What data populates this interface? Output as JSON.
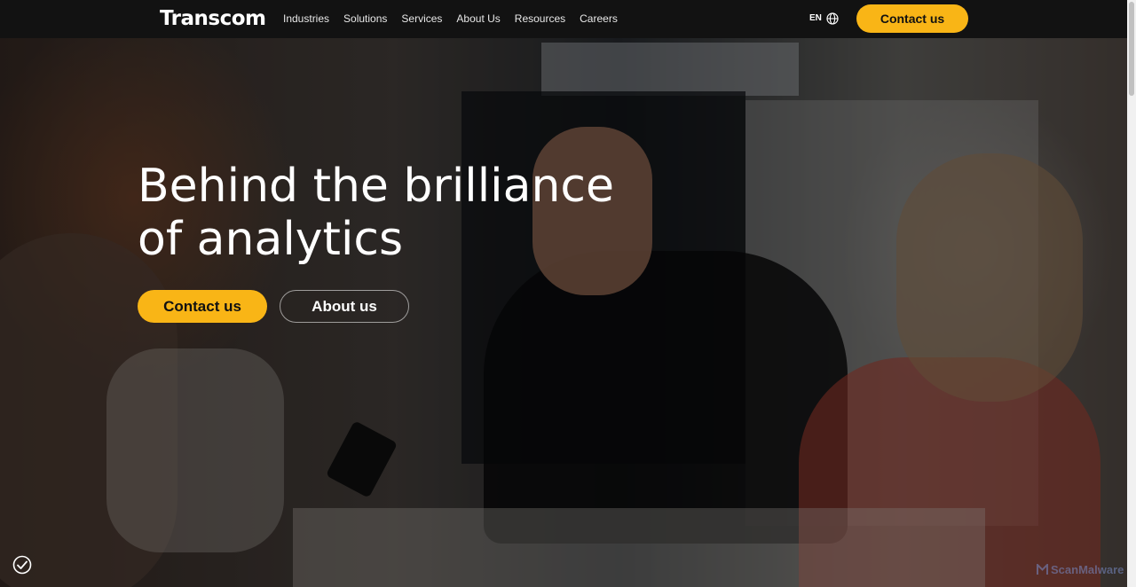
{
  "header": {
    "logo_text": "Transcom",
    "nav": [
      "Industries",
      "Solutions",
      "Services",
      "About Us",
      "Resources",
      "Careers"
    ],
    "language": "EN",
    "cta_label": "Contact us"
  },
  "hero": {
    "title": "Behind the brilliance of analytics",
    "primary_button": "Contact us",
    "secondary_button": "About us"
  },
  "watermark": "ScanMalware",
  "colors": {
    "accent": "#f9b516",
    "header_bg": "#121212"
  },
  "icons": {
    "globe": "globe-icon",
    "cookie": "cookie-settings-icon"
  }
}
